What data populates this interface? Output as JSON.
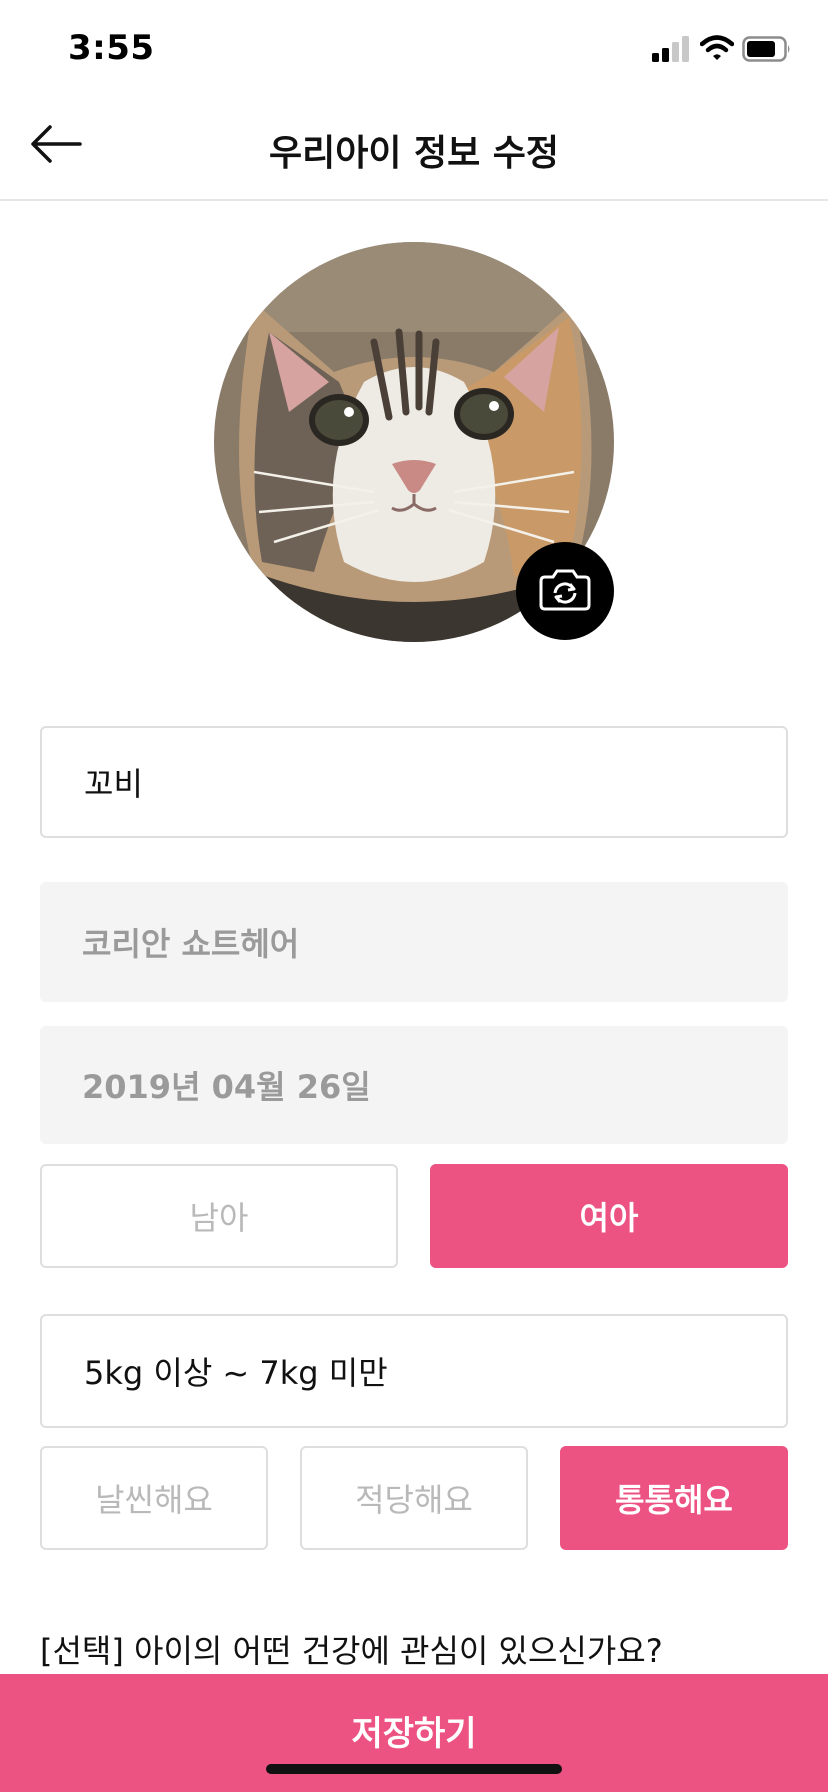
{
  "status_bar": {
    "time": "3:55",
    "icons": [
      "cellular-signal-icon",
      "wifi-icon",
      "battery-icon"
    ]
  },
  "header": {
    "back_icon": "arrow-left-icon",
    "title": "우리아이 정보 수정"
  },
  "profile": {
    "photo": "cat-photo",
    "camera_icon": "camera-rotate-icon"
  },
  "form": {
    "name_value": "꼬비",
    "breed_value": "코리안 쇼트헤어",
    "birthdate_value": "2019년 04월 26일",
    "gender": {
      "options": [
        "남아",
        "여아"
      ],
      "selected": "여아"
    },
    "weight_value": "5kg 이상 ~ 7kg 미만",
    "body_type": {
      "options": [
        "날씬해요",
        "적당해요",
        "통통해요"
      ],
      "selected": "통통해요"
    },
    "health_question": "[선택] 아이의 어떤 건강에 관심이 있으신가요?"
  },
  "footer": {
    "save_label": "저장하기"
  },
  "colors": {
    "accent": "#ec5282",
    "border": "#dedede",
    "readonly_bg": "#f4f4f4",
    "muted_text": "#b9b9b9"
  }
}
